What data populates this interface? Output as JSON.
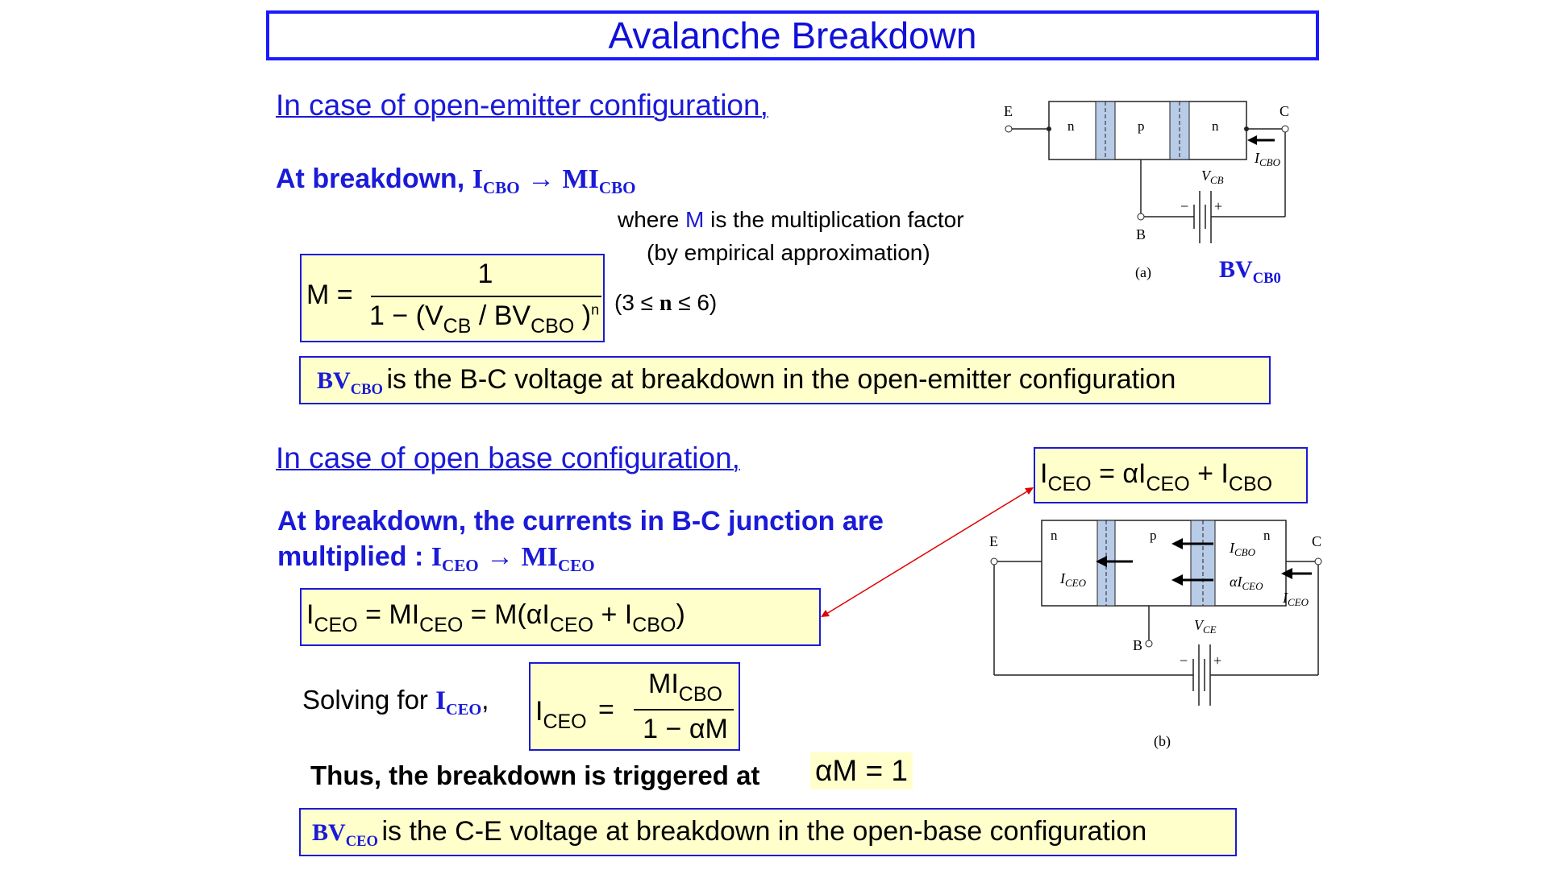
{
  "title": "Avalanche Breakdown",
  "section1": {
    "heading": "In case of open-emitter configuration,",
    "breakdown_prefix": "At breakdown,",
    "breakdown_lhs": "I",
    "breakdown_lhs_sub": "CBO",
    "arrow": "→",
    "breakdown_rhs": "MI",
    "breakdown_rhs_sub": "CBO",
    "where_prefix": "where",
    "where_M": "M",
    "where_suffix": "is the multiplication factor",
    "empirical": "(by empirical approximation)",
    "formula": {
      "lhs": "M =",
      "numerator": "1",
      "den_a": "1 − (V",
      "den_a_sub": "CB",
      "den_b": " / BV",
      "den_b_sub": "CBO",
      "den_c": " )",
      "den_exp": "n"
    },
    "range_a": "(3 ≤",
    "range_n": "n",
    "range_b": "≤ 6)",
    "bv_label": "BV",
    "bv_sub": "CBO",
    "bv_text": "is the B-C voltage at breakdown in the open-emitter configuration"
  },
  "diagram_a": {
    "E": "E",
    "C": "C",
    "B": "B",
    "n1": "n",
    "p": "p",
    "n2": "n",
    "icbo": "I",
    "icbo_sub": "CBO",
    "vcb": "V",
    "vcb_sub": "CB",
    "minus": "−",
    "plus": "+",
    "caption": "(a)",
    "bv": "BV",
    "bv_sub": "CB0"
  },
  "section2": {
    "heading": "In case of open base configuration,",
    "line1": "At breakdown, the currents in B-C junction are",
    "line2_prefix": "multiplied :",
    "line2_lhs": "I",
    "line2_lhs_sub": "CEO",
    "arrow": "→",
    "line2_rhs": "MI",
    "line2_rhs_sub": "CEO",
    "eq_top": {
      "a": "I",
      "a_sub": "CEO",
      "b": " = αI",
      "b_sub": "CEO",
      "c": " + I",
      "c_sub": "CBO"
    },
    "eq_main": {
      "a": "I",
      "a_sub": "CEO",
      "b": " = MI",
      "b_sub": "CEO",
      "c": " = M(αI",
      "c_sub": "CEO",
      "d": " + I",
      "d_sub": "CBO",
      "e": ")"
    },
    "solving_prefix": "Solving for",
    "solving_var": "I",
    "solving_var_sub": "CEO",
    "solving_comma": ",",
    "solve_eq": {
      "lhs": "I",
      "lhs_sub": "CEO",
      "eq": "=",
      "num": "MI",
      "num_sub": "CBO",
      "den": "1 − αM"
    },
    "trigger_text": "Thus, the breakdown is triggered at",
    "trigger_eq": "αM = 1",
    "bv_label": "BV",
    "bv_sub": "CEO",
    "bv_text": "is the C-E voltage at breakdown in the open-base configuration"
  },
  "diagram_b": {
    "E": "E",
    "C": "C",
    "B": "B",
    "n1": "n",
    "p": "p",
    "n2": "n",
    "iceo_left": "I",
    "iceo_left_sub": "CEO",
    "icbo": "I",
    "icbo_sub": "CBO",
    "aiceo": "αI",
    "aiceo_sub": "CEO",
    "iceo_right": "I",
    "iceo_right_sub": "CEO",
    "vce": "V",
    "vce_sub": "CE",
    "minus": "−",
    "plus": "+",
    "caption": "(b)"
  },
  "colors": {
    "accent": "#1a1ad8",
    "box_fill": "#ffffcc",
    "junction": "#b8cce8",
    "arrow_red": "#e00000"
  }
}
